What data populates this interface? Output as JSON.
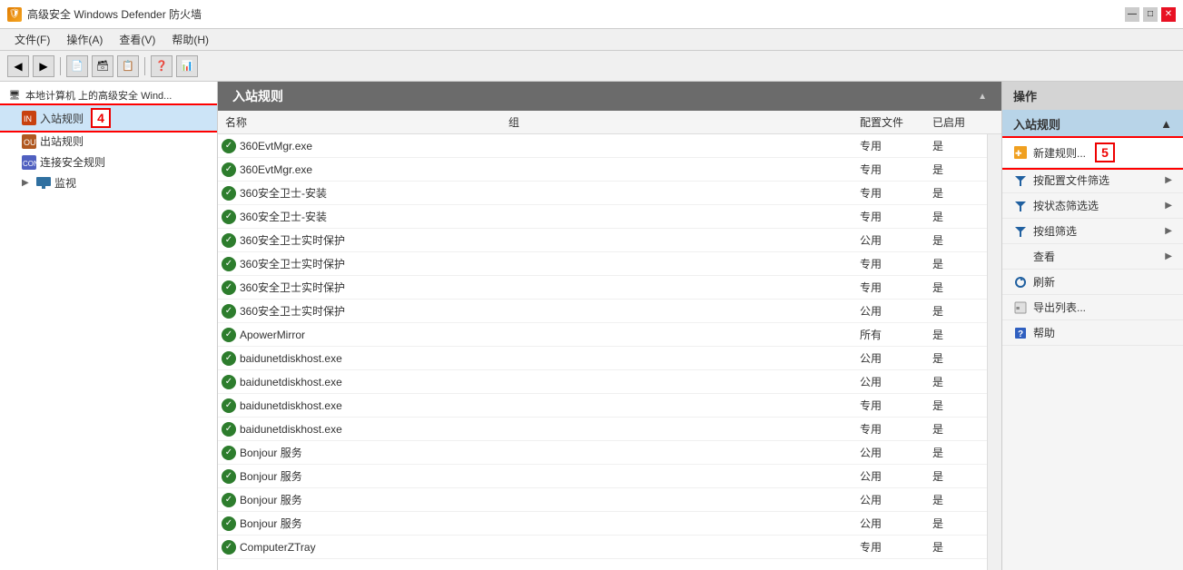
{
  "window": {
    "title": "高级安全 Windows Defender 防火墙",
    "title_icon": "🔥",
    "controls": [
      "—",
      "□",
      "✕"
    ]
  },
  "menu": {
    "items": [
      {
        "label": "文件(F)"
      },
      {
        "label": "操作(A)"
      },
      {
        "label": "查看(V)"
      },
      {
        "label": "帮助(H)"
      }
    ]
  },
  "toolbar": {
    "buttons": [
      "◀",
      "▶",
      "📄",
      "🗃",
      "📋",
      "❓",
      "📊"
    ]
  },
  "left_panel": {
    "root_label": "本地计算机 上的高级安全 Wind...",
    "tree_items": [
      {
        "label": "入站规则",
        "selected": true,
        "step": "4"
      },
      {
        "label": "出站规则",
        "selected": false
      },
      {
        "label": "连接安全规则",
        "selected": false
      },
      {
        "label": "监视",
        "selected": false,
        "has_expand": true
      }
    ]
  },
  "center_panel": {
    "header": "入站规则",
    "columns": [
      {
        "label": "名称",
        "class": "th-name"
      },
      {
        "label": "组",
        "class": "th-group"
      },
      {
        "label": "配置文件",
        "class": "th-profile"
      },
      {
        "label": "已启用",
        "class": "th-enabled"
      }
    ],
    "rows": [
      {
        "name": "360EvtMgr.exe",
        "group": "",
        "profile": "专用",
        "enabled": "是"
      },
      {
        "name": "360EvtMgr.exe",
        "group": "",
        "profile": "专用",
        "enabled": "是"
      },
      {
        "name": "360安全卫士-安装",
        "group": "",
        "profile": "专用",
        "enabled": "是"
      },
      {
        "name": "360安全卫士-安装",
        "group": "",
        "profile": "专用",
        "enabled": "是"
      },
      {
        "name": "360安全卫士实时保护",
        "group": "",
        "profile": "公用",
        "enabled": "是"
      },
      {
        "name": "360安全卫士实时保护",
        "group": "",
        "profile": "专用",
        "enabled": "是"
      },
      {
        "name": "360安全卫士实时保护",
        "group": "",
        "profile": "专用",
        "enabled": "是"
      },
      {
        "name": "360安全卫士实时保护",
        "group": "",
        "profile": "公用",
        "enabled": "是"
      },
      {
        "name": "ApowerMirror",
        "group": "",
        "profile": "所有",
        "enabled": "是"
      },
      {
        "name": "baidunetdiskhost.exe",
        "group": "",
        "profile": "公用",
        "enabled": "是"
      },
      {
        "name": "baidunetdiskhost.exe",
        "group": "",
        "profile": "公用",
        "enabled": "是"
      },
      {
        "name": "baidunetdiskhost.exe",
        "group": "",
        "profile": "专用",
        "enabled": "是"
      },
      {
        "name": "baidunetdiskhost.exe",
        "group": "",
        "profile": "专用",
        "enabled": "是"
      },
      {
        "name": "Bonjour 服务",
        "group": "",
        "profile": "公用",
        "enabled": "是"
      },
      {
        "name": "Bonjour 服务",
        "group": "",
        "profile": "公用",
        "enabled": "是"
      },
      {
        "name": "Bonjour 服务",
        "group": "",
        "profile": "公用",
        "enabled": "是"
      },
      {
        "name": "Bonjour 服务",
        "group": "",
        "profile": "公用",
        "enabled": "是"
      },
      {
        "name": "ComputerZTray",
        "group": "",
        "profile": "专用",
        "enabled": "是"
      }
    ]
  },
  "right_panel": {
    "section_label": "操作",
    "main_section": "入站规则",
    "items": [
      {
        "label": "新建规则...",
        "step": "5",
        "highlighted": true,
        "has_icon": true
      },
      {
        "label": "按配置文件筛选",
        "has_submenu": true,
        "has_icon": true
      },
      {
        "label": "按状态筛选选",
        "has_submenu": true,
        "has_icon": true
      },
      {
        "label": "按组筛选",
        "has_submenu": true,
        "has_icon": true
      },
      {
        "label": "查看",
        "has_submenu": true
      },
      {
        "label": "刷新",
        "has_icon": true
      },
      {
        "label": "导出列表...",
        "has_icon": true
      },
      {
        "label": "帮助",
        "has_icon": true
      }
    ]
  }
}
